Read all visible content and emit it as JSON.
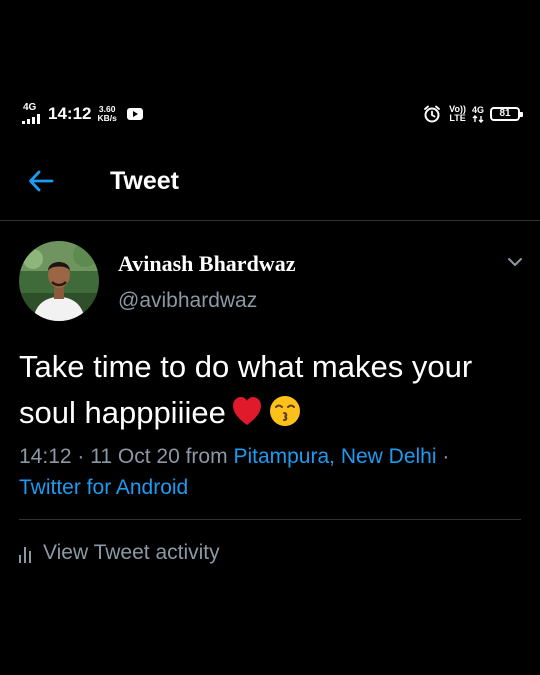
{
  "status_bar": {
    "network": "4G",
    "time": "14:12",
    "speed_value": "3.60",
    "speed_unit": "KB/s",
    "volte_top": "Vo))",
    "volte_bottom": "LTE",
    "data_network": "4G",
    "battery": "81",
    "icons": [
      "signal-icon",
      "media-icon",
      "alarm-icon",
      "battery-icon"
    ]
  },
  "header": {
    "title": "Tweet",
    "back_icon": "arrow-left-icon"
  },
  "tweet": {
    "author_name": "Avinash Bhardwaz",
    "author_handle": "@avibhardwaz",
    "text": "Take time to do what makes your soul happpiiiee",
    "emojis": [
      "red-heart",
      "kissing-face-with-closed-eyes"
    ],
    "time": "14:12",
    "separator": "·",
    "date": "11 Oct 20",
    "from_label": "from",
    "location": "Pitampura, New Delhi",
    "source": "Twitter for Android",
    "activity_label": "View Tweet activity"
  },
  "colors": {
    "background": "#000000",
    "text": "#ffffff",
    "muted": "#8b98a5",
    "accent": "#1d9bf0",
    "divider": "#2f3336"
  }
}
